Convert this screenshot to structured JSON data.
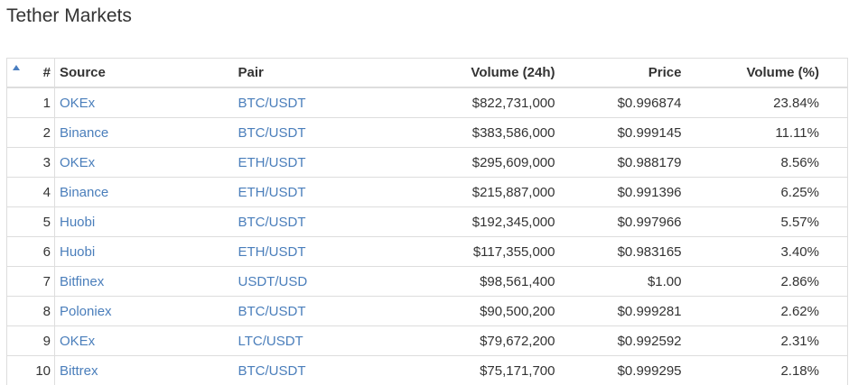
{
  "page": {
    "title": "Tether Markets"
  },
  "table": {
    "headers": {
      "sort_icon": "sort-ascending-icon",
      "rank": "#",
      "source": "Source",
      "pair": "Pair",
      "volume": "Volume (24h)",
      "price": "Price",
      "share": "Volume (%)"
    },
    "rows": [
      {
        "rank": "1",
        "source": "OKEx",
        "pair": "BTC/USDT",
        "volume": "$822,731,000",
        "price": "$0.996874",
        "share": "23.84%"
      },
      {
        "rank": "2",
        "source": "Binance",
        "pair": "BTC/USDT",
        "volume": "$383,586,000",
        "price": "$0.999145",
        "share": "11.11%"
      },
      {
        "rank": "3",
        "source": "OKEx",
        "pair": "ETH/USDT",
        "volume": "$295,609,000",
        "price": "$0.988179",
        "share": "8.56%"
      },
      {
        "rank": "4",
        "source": "Binance",
        "pair": "ETH/USDT",
        "volume": "$215,887,000",
        "price": "$0.991396",
        "share": "6.25%"
      },
      {
        "rank": "5",
        "source": "Huobi",
        "pair": "BTC/USDT",
        "volume": "$192,345,000",
        "price": "$0.997966",
        "share": "5.57%"
      },
      {
        "rank": "6",
        "source": "Huobi",
        "pair": "ETH/USDT",
        "volume": "$117,355,000",
        "price": "$0.983165",
        "share": "3.40%"
      },
      {
        "rank": "7",
        "source": "Bitfinex",
        "pair": "USDT/USD",
        "volume": "$98,561,400",
        "price": "$1.00",
        "share": "2.86%"
      },
      {
        "rank": "8",
        "source": "Poloniex",
        "pair": "BTC/USDT",
        "volume": "$90,500,200",
        "price": "$0.999281",
        "share": "2.62%"
      },
      {
        "rank": "9",
        "source": "OKEx",
        "pair": "LTC/USDT",
        "volume": "$79,672,200",
        "price": "$0.992592",
        "share": "2.31%"
      },
      {
        "rank": "10",
        "source": "Bittrex",
        "pair": "BTC/USDT",
        "volume": "$75,171,700",
        "price": "$0.999295",
        "share": "2.18%"
      }
    ]
  },
  "colors": {
    "link": "#4a7ebb",
    "text": "#333333",
    "border": "#dddddd",
    "sort_icon": "#4a7ec0"
  }
}
